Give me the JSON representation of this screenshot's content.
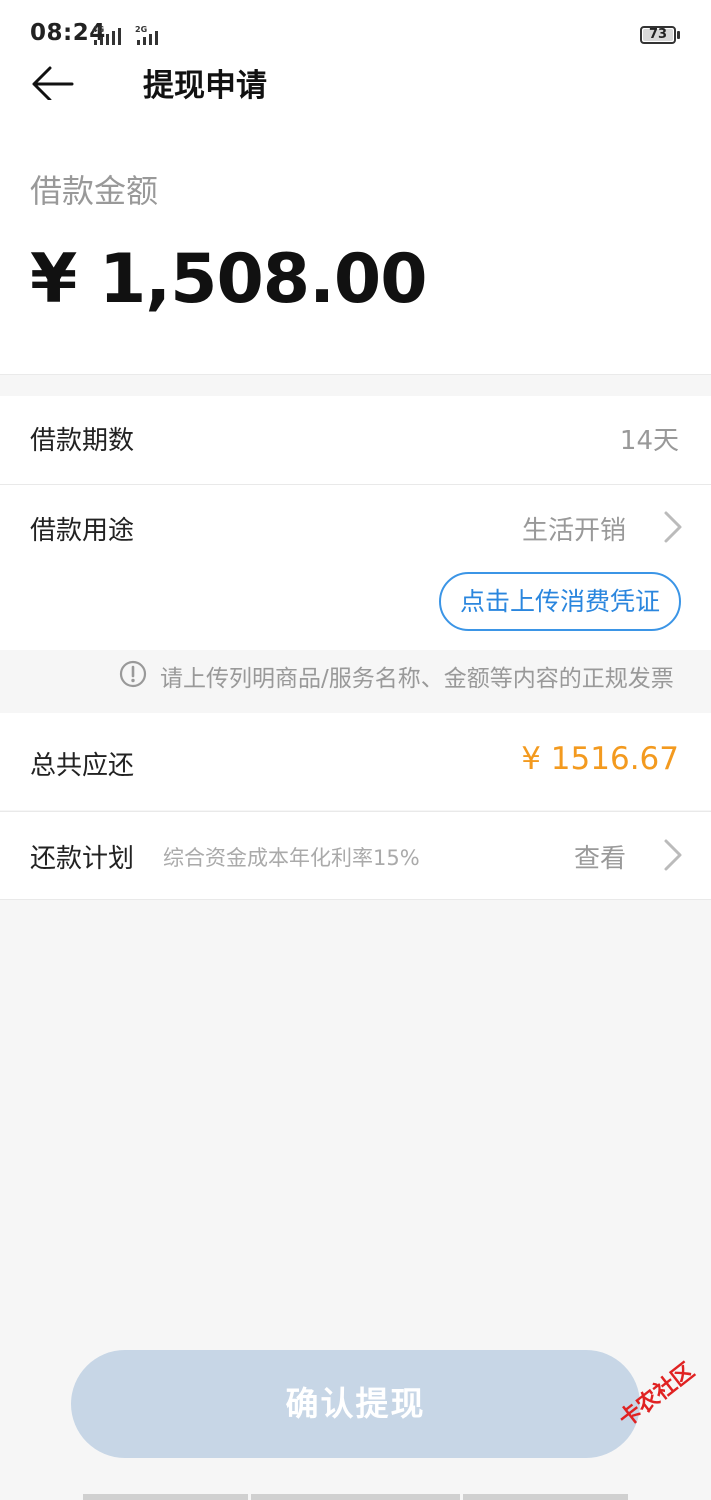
{
  "status_bar": {
    "time": "08:24",
    "network_1": "4G",
    "network_2": "2G",
    "battery": "73"
  },
  "header": {
    "title": "提现申请",
    "back_icon": "arrow-left-icon"
  },
  "amount": {
    "label": "借款金额",
    "value": "¥ 1,508.00"
  },
  "term": {
    "label": "借款期数",
    "value": "14天"
  },
  "purpose": {
    "label": "借款用途",
    "value": "生活开销",
    "upload_button": "点击上传消费凭证"
  },
  "notice": {
    "icon": "exclamation-circle-icon",
    "text": "请上传列明商品/服务名称、金额等内容的正规发票"
  },
  "total": {
    "label": "总共应还",
    "value": "¥ 1516.67"
  },
  "plan": {
    "label": "还款计划",
    "subtext": "综合资金成本年化利率15%",
    "action": "查看"
  },
  "confirm_button": "确认提现",
  "watermark": "卡农社区",
  "colors": {
    "accent_blue": "#2a86de",
    "total_orange": "#f39a1f",
    "button_disabled": "#c7d6e6"
  }
}
